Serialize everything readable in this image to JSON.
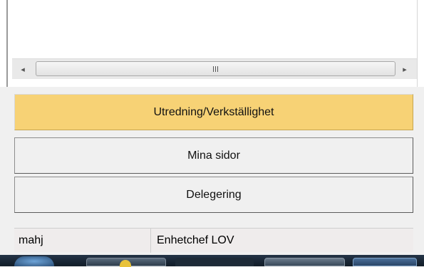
{
  "scrollbar": {
    "left_arrow": "◂",
    "right_arrow": "▸",
    "grip": "III"
  },
  "nav": {
    "items": [
      {
        "label": "Utredning/Verkställighet",
        "active": true
      },
      {
        "label": "Mina sidor",
        "active": false
      },
      {
        "label": "Delegering",
        "active": false
      }
    ]
  },
  "status": {
    "user": "mahj",
    "role": "Enhetchef LOV"
  },
  "colors": {
    "active_button": "#f7d275",
    "button": "#f0f0f0"
  }
}
